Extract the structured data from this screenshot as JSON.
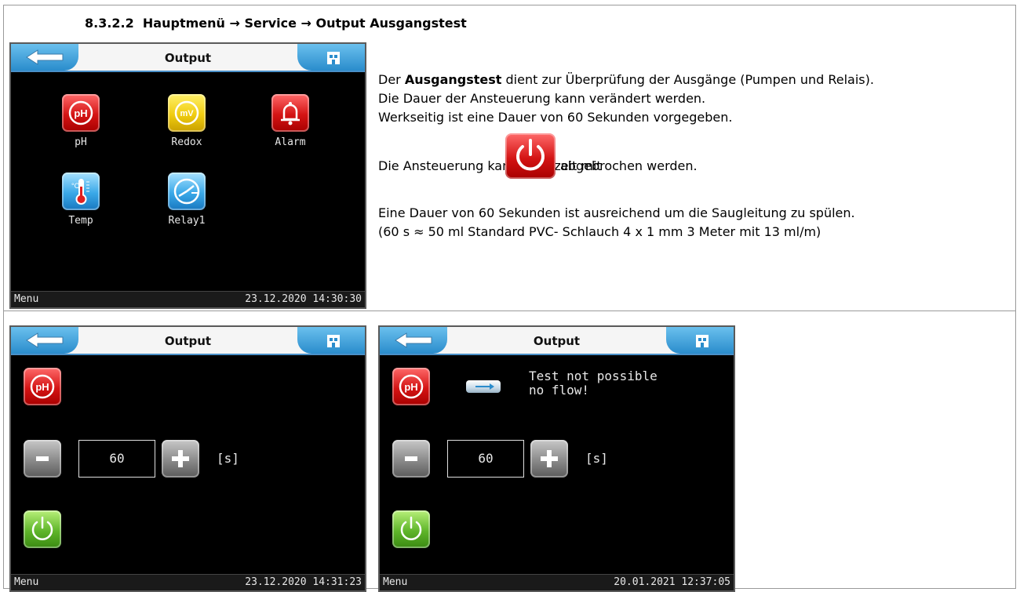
{
  "heading": {
    "number": "8.3.2.2",
    "part1": "Hauptmenü",
    "arrow": "→",
    "part2": "Service",
    "part3": "Output Ausgangstest"
  },
  "description": {
    "line1_pre": "Der ",
    "line1_bold": "Ausgangstest",
    "line1_post": " dient zur Überprüfung der Ausgänge (Pumpen und Relais).",
    "line2": "Die Dauer der Ansteuerung kann verändert werden.",
    "line3": "Werkseitig ist eine Dauer von 60 Sekunden vorgegeben.",
    "line4_pre": "Die Ansteuerung kann jederzeit mit",
    "line4_post": "abgebrochen werden.",
    "line5": "Eine Dauer von 60 Sekunden ist ausreichend um die Saugleitung zu spülen.",
    "line6": "(60 s ≈ 50 ml Standard PVC- Schlauch 4 x 1 mm 3 Meter mit 13 ml/m)"
  },
  "screen_menu": {
    "title": "Output",
    "tiles": [
      "pH",
      "Redox",
      "Alarm",
      "Temp",
      "Relay1"
    ],
    "status_left": "Menu",
    "status_right": "23.12.2020 14:30:30"
  },
  "screen_test": {
    "title": "Output",
    "icon_text": "pH",
    "value": "60",
    "unit": "[s]",
    "status_left": "Menu",
    "status_right": "23.12.2020 14:31:23"
  },
  "screen_noflow": {
    "title": "Output",
    "icon_text": "pH",
    "message_line1": "Test not possible",
    "message_line2": "no flow!",
    "value": "60",
    "unit": "[s]",
    "status_left": "Menu",
    "status_right": "20.01.2021 12:37:05"
  },
  "icon_labels": {
    "ph": "pH",
    "mv": "mV"
  },
  "colors": {
    "red": "#d41414",
    "yellow": "#f0cc10",
    "blue": "#3aa8e8",
    "green": "#5fb52a",
    "grey": "#8a8a8a",
    "header_accent": "#2a8ccc"
  }
}
